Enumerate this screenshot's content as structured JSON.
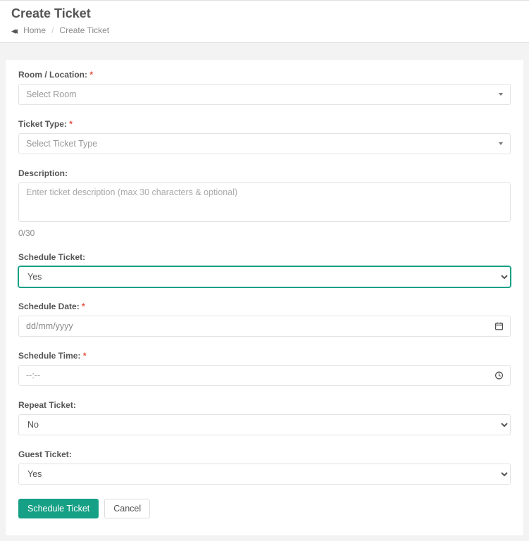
{
  "header": {
    "title": "Create Ticket",
    "breadcrumb_home": "Home",
    "breadcrumb_current": "Create Ticket"
  },
  "form": {
    "room_label": "Room / Location:",
    "room_placeholder": "Select Room",
    "type_label": "Ticket Type:",
    "type_placeholder": "Select Ticket Type",
    "desc_label": "Description:",
    "desc_placeholder": "Enter ticket description (max 30 characters & optional)",
    "desc_counter": "0/30",
    "schedule_label": "Schedule Ticket:",
    "schedule_value": "Yes",
    "date_label": "Schedule Date:",
    "date_placeholder": "dd/mm/yyyy",
    "time_label": "Schedule Time:",
    "time_placeholder": "--:--",
    "repeat_label": "Repeat Ticket:",
    "repeat_value": "No",
    "guest_label": "Guest Ticket:",
    "guest_value": "Yes"
  },
  "buttons": {
    "submit": "Schedule Ticket",
    "cancel": "Cancel"
  }
}
